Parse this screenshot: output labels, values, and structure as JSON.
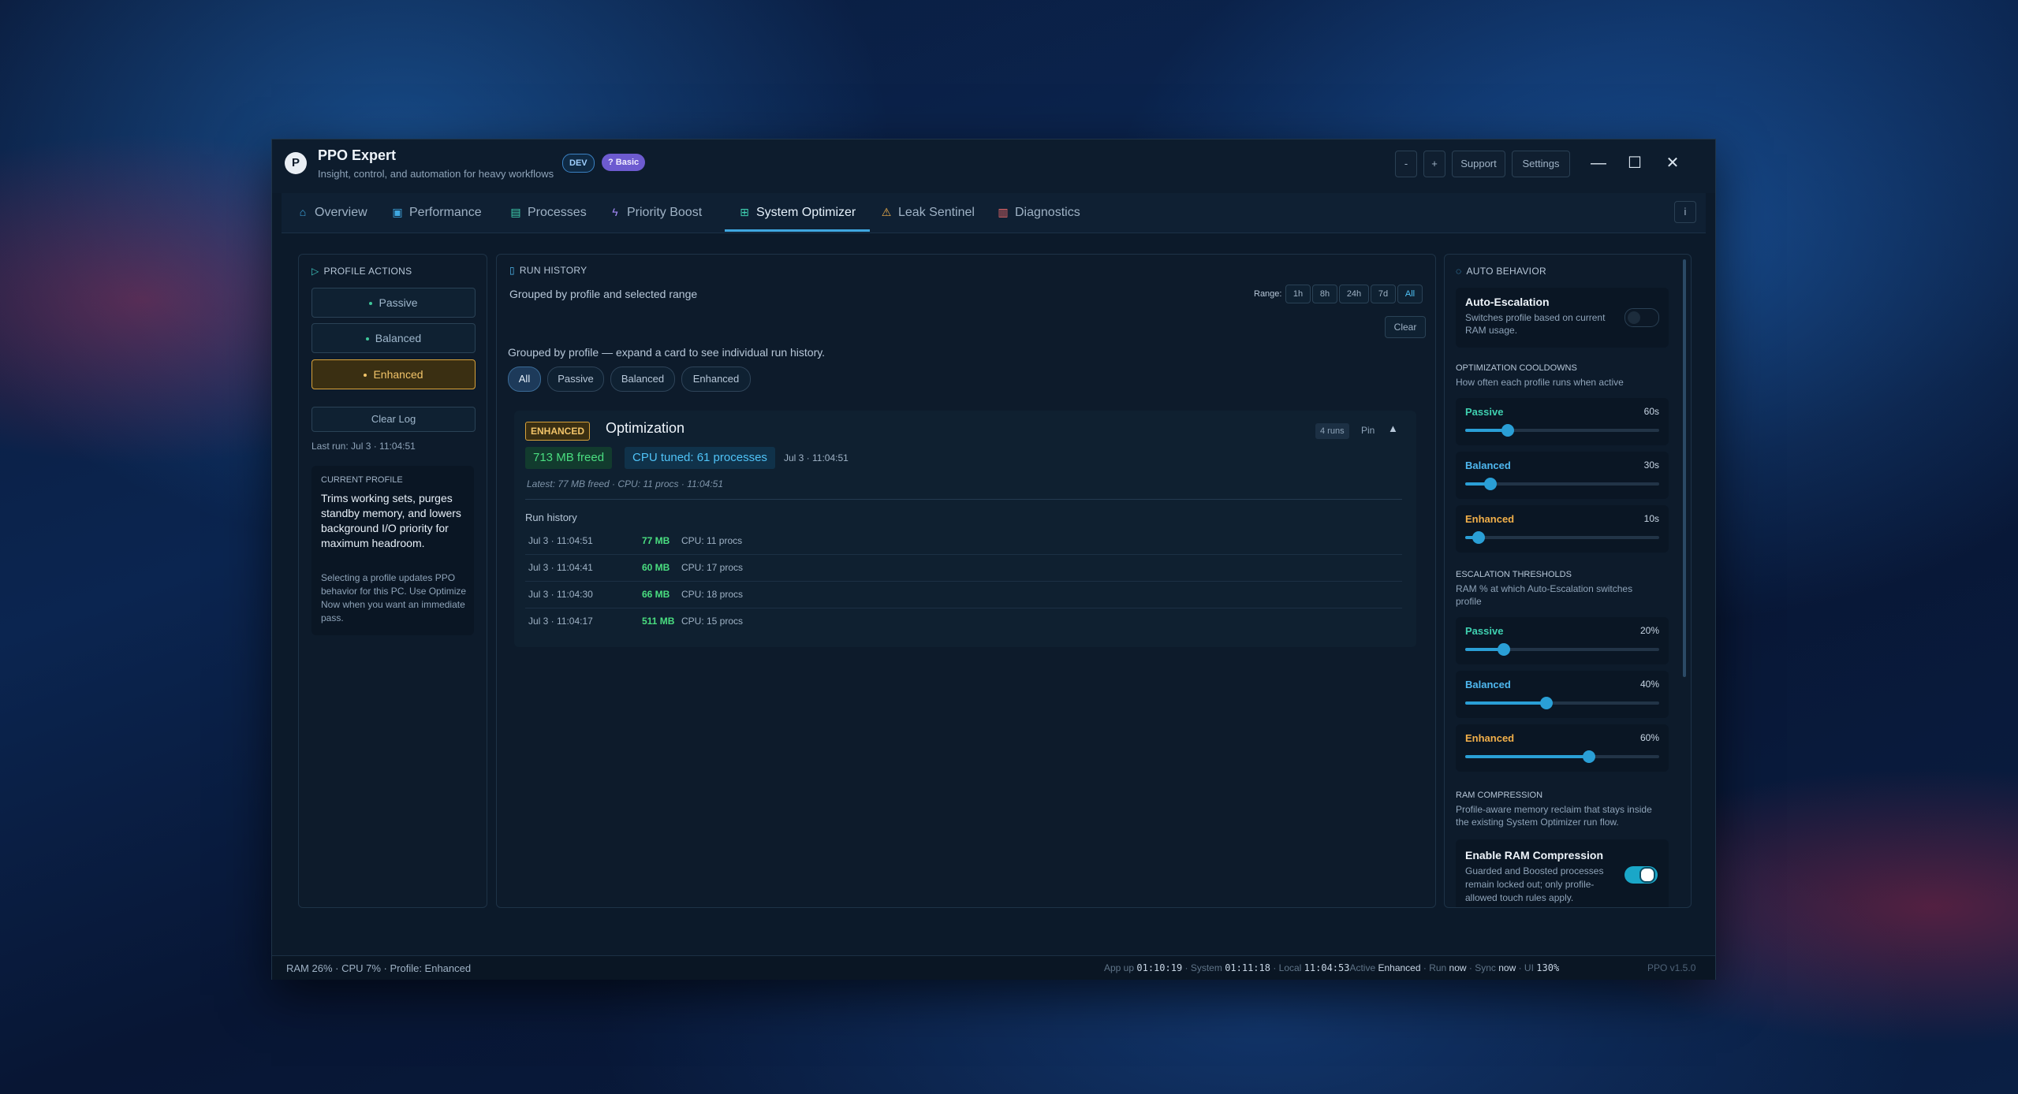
{
  "app": {
    "logo_letter": "P",
    "title": "PPO Expert",
    "subtitle": "Insight, control, and automation for heavy workflows",
    "badge_dev": "DEV",
    "badge_basic": "? Basic"
  },
  "titlebar": {
    "zoom_out": "-",
    "zoom_in": "+",
    "support": "Support",
    "settings": "Settings",
    "minimize": "—",
    "maximize": "☐",
    "close": "✕"
  },
  "tabs": [
    {
      "label": "Overview",
      "icon": "home-icon",
      "glyph": "⌂"
    },
    {
      "label": "Performance",
      "icon": "chart-icon",
      "glyph": "▣"
    },
    {
      "label": "Processes",
      "icon": "document-icon",
      "glyph": "▤"
    },
    {
      "label": "Priority Boost",
      "icon": "lightning-icon",
      "glyph": "ϟ"
    },
    {
      "label": "System Optimizer",
      "icon": "gamepad-icon",
      "glyph": "⊞"
    },
    {
      "label": "Leak Sentinel",
      "icon": "warning-icon",
      "glyph": "⚠"
    },
    {
      "label": "Diagnostics",
      "icon": "diagnostics-icon",
      "glyph": "▥"
    }
  ],
  "info_button": "i",
  "left_panel": {
    "heading": "PROFILE ACTIONS",
    "profiles": [
      "Passive",
      "Balanced",
      "Enhanced"
    ],
    "active_profile": "Enhanced",
    "clear_log": "Clear Log",
    "last_run": "Last run: Jul 3 · 11:04:51",
    "current_profile": {
      "heading": "CURRENT PROFILE",
      "description": "Trims working sets, purges standby memory, and lowers background I/O priority for maximum headroom.",
      "note": "Selecting a profile updates PPO behavior for this PC. Use Optimize Now when you want an immediate pass."
    }
  },
  "run_history": {
    "heading": "RUN HISTORY",
    "subtitle": "Grouped by profile and selected range",
    "range_label": "Range:",
    "ranges": [
      "1h",
      "8h",
      "24h",
      "7d",
      "All"
    ],
    "active_range": "All",
    "clear": "Clear",
    "grouped_note": "Grouped by profile — expand a card to see individual run history.",
    "filters": [
      "All",
      "Passive",
      "Balanced",
      "Enhanced"
    ],
    "active_filter": "All",
    "card": {
      "tag": "ENHANCED",
      "title": "Optimization",
      "runs": "4 runs",
      "pin": "Pin",
      "caret": "▲",
      "freed": "713 MB freed",
      "cpu_tuned": "CPU tuned: 61 processes",
      "time": "Jul 3 · 11:04:51",
      "latest": "Latest: 77 MB freed · CPU: 11 procs · 11:04:51",
      "history_heading": "Run history",
      "rows": [
        {
          "time": "Jul 3 · 11:04:51",
          "mem": "77 MB",
          "cpu": "CPU: 11 procs"
        },
        {
          "time": "Jul 3 · 11:04:41",
          "mem": "60 MB",
          "cpu": "CPU: 17 procs"
        },
        {
          "time": "Jul 3 · 11:04:30",
          "mem": "66 MB",
          "cpu": "CPU: 18 procs"
        },
        {
          "time": "Jul 3 · 11:04:17",
          "mem": "511 MB",
          "cpu": "CPU: 15 procs"
        }
      ]
    }
  },
  "auto_behavior": {
    "heading": "AUTO BEHAVIOR",
    "auto_escalation": {
      "title": "Auto-Escalation",
      "description": "Switches profile based on current RAM usage.",
      "enabled": false
    },
    "cooldowns": {
      "heading": "OPTIMIZATION COOLDOWNS",
      "description": "How often each profile runs when active",
      "items": [
        {
          "name": "Passive",
          "value": "60s",
          "level": 0.22
        },
        {
          "name": "Balanced",
          "value": "30s",
          "level": 0.13
        },
        {
          "name": "Enhanced",
          "value": "10s",
          "level": 0.07
        }
      ]
    },
    "thresholds": {
      "heading": "ESCALATION THRESHOLDS",
      "description": "RAM % at which Auto-Escalation switches profile",
      "items": [
        {
          "name": "Passive",
          "value": "20%",
          "level": 0.2
        },
        {
          "name": "Balanced",
          "value": "40%",
          "level": 0.42
        },
        {
          "name": "Enhanced",
          "value": "60%",
          "level": 0.64
        }
      ]
    },
    "ram_compression": {
      "heading": "RAM COMPRESSION",
      "description": "Profile-aware memory reclaim that stays inside the existing System Optimizer run flow.",
      "title": "Enable RAM Compression",
      "card_description": "Guarded and Boosted processes remain locked out; only profile-allowed touch rules apply.",
      "enabled": true
    }
  },
  "statusbar": {
    "left": "RAM 26%  ·  CPU 7%  ·  Profile: Enhanced",
    "app_up_label": "App up ",
    "app_up": "01:10:19",
    "system_label": " · System ",
    "system": "01:11:18",
    "local_label": " · Local ",
    "local": "11:04:53",
    "active_label": "Active ",
    "active": "Enhanced",
    "run_label": " · Run ",
    "run": "now",
    "sync_label": " · Sync ",
    "sync": "now",
    "ui_label": "  · UI ",
    "ui": "130%",
    "version": "PPO v1.5.0"
  }
}
